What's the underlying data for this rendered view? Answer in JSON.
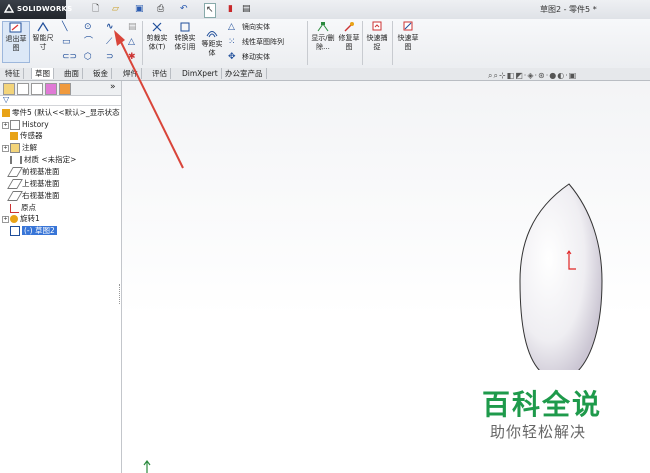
{
  "app": {
    "logo_text": "SOLIDWORKS",
    "doc_title": "草图2 - 零件5 *"
  },
  "quick_access": {
    "icons": [
      "new-icon",
      "open-icon",
      "save-icon",
      "print-icon",
      "undo-icon",
      "select-icon",
      "rebuild-icon",
      "options-icon"
    ]
  },
  "ribbon": {
    "exit_sketch": "退出草图",
    "smart_dim": "智能尺寸",
    "trim": "剪裁实体(T)",
    "convert": "转换实体引用",
    "offset": "等距实体",
    "mirror": "镜向实体",
    "linear_pattern": "线性草图阵列",
    "move": "移动实体",
    "display_delete": "显示/删除...",
    "repair": "修复草图",
    "quick_snaps": "快速捕捉",
    "rapid_sketch": "快速草图"
  },
  "tabs": [
    "特征",
    "草图",
    "曲面",
    "钣金",
    "焊件",
    "评估",
    "DimXpert",
    "办公室产品"
  ],
  "active_tab": "草图",
  "tree": {
    "root": "零件5 (默认<<默认>_显示状态",
    "items": [
      "History",
      "传感器",
      "注解",
      "材质 <未指定>",
      "前视基准面",
      "上视基准面",
      "右视基准面",
      "原点",
      "旋转1",
      "(-) 草图2"
    ]
  },
  "watermark": {
    "title": "百科全说",
    "subtitle": "助你轻松解决"
  },
  "colors": {
    "accent": "#1f4e9a",
    "arrow": "#d9453a",
    "watermark_green": "#1e9a4b",
    "origin": "#e02424"
  }
}
